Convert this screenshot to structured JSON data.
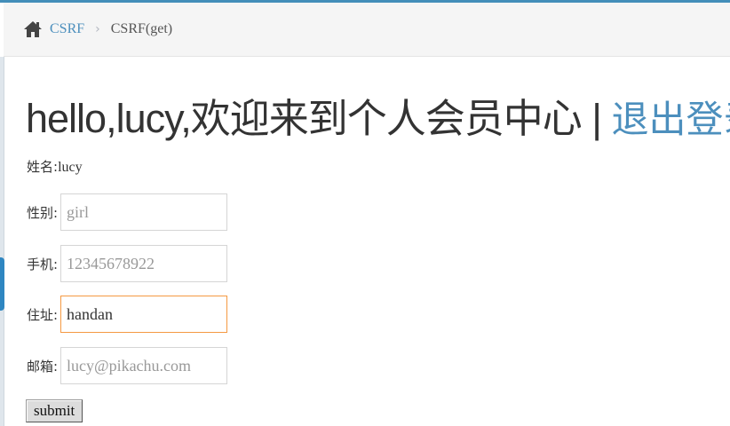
{
  "breadcrumb": {
    "home_icon": "home-icon",
    "link_label": "CSRF",
    "separator": "›",
    "current_label": "CSRF(get)"
  },
  "welcome": {
    "text": "hello,lucy,欢迎来到个人会员中心 | ",
    "logout_label": "退出登录"
  },
  "profile": {
    "name_label": "姓名:",
    "name_value": "lucy"
  },
  "form": {
    "sex": {
      "label": "性别:",
      "value": "",
      "placeholder": "girl"
    },
    "phone": {
      "label": "手机:",
      "value": "",
      "placeholder": "12345678922"
    },
    "address": {
      "label": "住址:",
      "value": "handan",
      "placeholder": ""
    },
    "email": {
      "label": "邮箱:",
      "value": "",
      "placeholder": "lucy@pikachu.com"
    },
    "submit_label": "submit"
  },
  "colors": {
    "accent": "#438eb9",
    "link": "#4c8fbd",
    "focus_border": "#f59942"
  }
}
